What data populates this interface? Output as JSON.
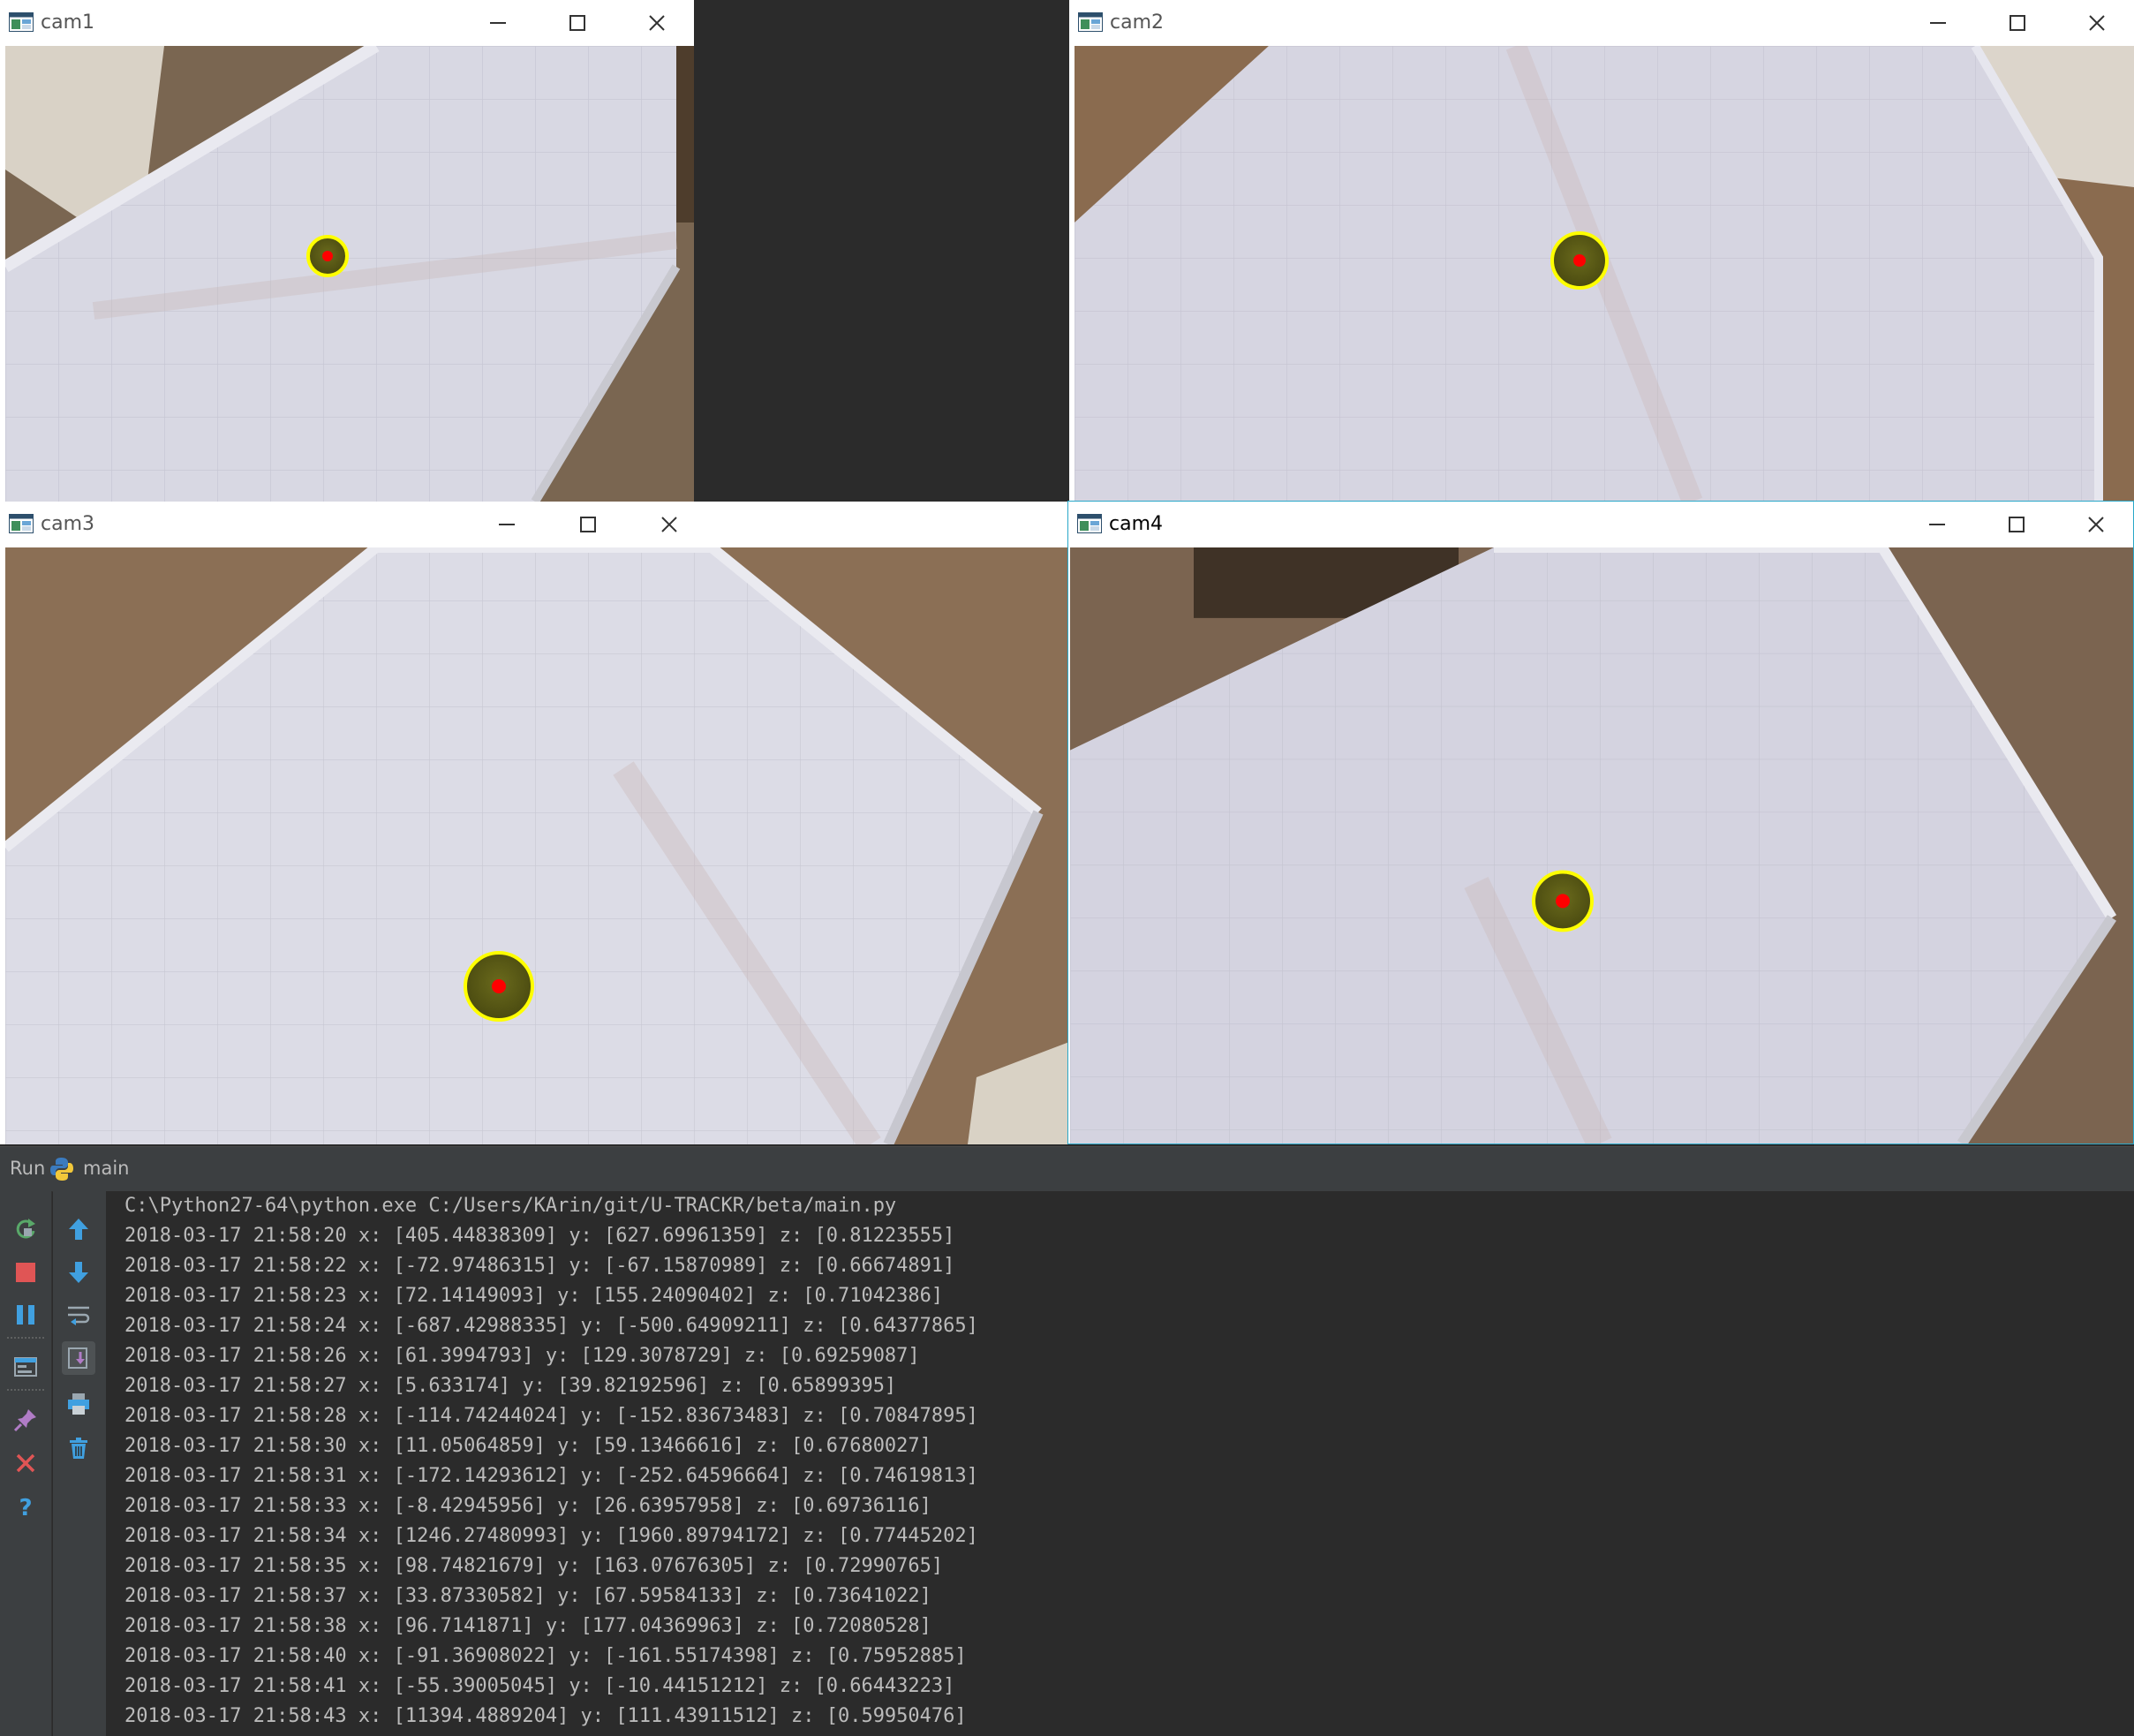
{
  "windows": [
    {
      "title": "cam1"
    },
    {
      "title": "cam2"
    },
    {
      "title": "cam3"
    },
    {
      "title": "cam4"
    }
  ],
  "run_panel": {
    "tab_label": "Run",
    "config_name": "main",
    "command": "C:\\Python27-64\\python.exe C:/Users/KArin/git/U-TRACKR/beta/main.py",
    "log_lines": [
      "2018-03-17 21:58:20 x: [405.44838309] y: [627.69961359] z: [0.81223555]",
      "2018-03-17 21:58:22 x: [-72.97486315] y: [-67.15870989] z: [0.66674891]",
      "2018-03-17 21:58:23 x: [72.14149093] y: [155.24090402] z: [0.71042386]",
      "2018-03-17 21:58:24 x: [-687.42988335] y: [-500.64909211] z: [0.64377865]",
      "2018-03-17 21:58:26 x: [61.3994793] y: [129.3078729] z: [0.69259087]",
      "2018-03-17 21:58:27 x: [5.633174] y: [39.82192596] z: [0.65899395]",
      "2018-03-17 21:58:28 x: [-114.74244024] y: [-152.83673483] z: [0.70847895]",
      "2018-03-17 21:58:30 x: [11.05064859] y: [59.13466616] z: [0.67680027]",
      "2018-03-17 21:58:31 x: [-172.14293612] y: [-252.64596664] z: [0.74619813]",
      "2018-03-17 21:58:33 x: [-8.42945956] y: [26.63957958] z: [0.69736116]",
      "2018-03-17 21:58:34 x: [1246.27480993] y: [1960.89794172] z: [0.77445202]",
      "2018-03-17 21:58:35 x: [98.74821679] y: [163.07676305] z: [0.72990765]",
      "2018-03-17 21:58:37 x: [33.87330582] y: [67.59584133] z: [0.73641022]",
      "2018-03-17 21:58:38 x: [96.7141871] y: [177.04369963] z: [0.72080528]",
      "2018-03-17 21:58:40 x: [-91.36908022] y: [-161.55174398] z: [0.75952885]",
      "2018-03-17 21:58:41 x: [-55.39005045] y: [-10.44151212] z: [0.66443223]",
      "2018-03-17 21:58:43 x: [11394.4889204] y: [111.43911512] z: [0.59950476]"
    ]
  },
  "icons": {
    "run_toolbar": [
      "rerun-icon",
      "stop-icon",
      "pause-icon",
      "layout-icon",
      "pin-icon",
      "close-icon",
      "help-icon"
    ],
    "console_toolbar": [
      "up-arrow-icon",
      "down-arrow-icon",
      "soft-wrap-icon",
      "scroll-to-end-icon",
      "print-icon",
      "trash-icon"
    ]
  },
  "colors": {
    "console_bg": "#2b2b2b",
    "console_text": "#bbbbbb",
    "tracker_circle": "#ffff00",
    "tracker_center": "#ff0000"
  }
}
